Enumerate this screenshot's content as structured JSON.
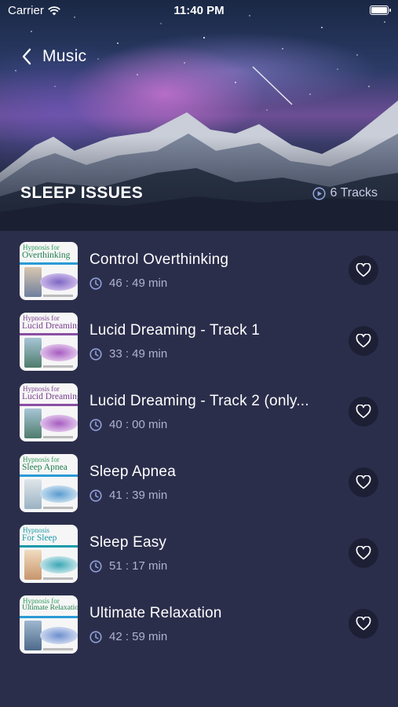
{
  "status_bar": {
    "carrier": "Carrier",
    "time": "11:40 PM"
  },
  "header": {
    "back_label": "Music",
    "title": "SLEEP ISSUES",
    "track_count": "6 Tracks"
  },
  "colors": {
    "list_bg": "#2b2e4b",
    "fav_bg": "#1d1f35",
    "muted_text": "#aeb3cf",
    "accent": "#8fa0d8"
  },
  "tracks": [
    {
      "title": "Control Overthinking",
      "duration": "46 : 49 min",
      "cover_top": "Hypnosis for",
      "cover_main": "Overthinking"
    },
    {
      "title": "Lucid Dreaming - Track 1",
      "duration": "33 : 49 min",
      "cover_top": "Hypnosis for",
      "cover_main": "Lucid Dreaming"
    },
    {
      "title": "Lucid Dreaming - Track 2 (only...",
      "duration": "40 : 00 min",
      "cover_top": "Hypnosis for",
      "cover_main": "Lucid Dreaming"
    },
    {
      "title": "Sleep Apnea",
      "duration": "41 : 39 min",
      "cover_top": "Hypnosis for",
      "cover_main": "Sleep Apnea"
    },
    {
      "title": "Sleep Easy",
      "duration": "51 : 17 min",
      "cover_top": "Hypnosis",
      "cover_main": "For Sleep"
    },
    {
      "title": "Ultimate Relaxation",
      "duration": "42 : 59 min",
      "cover_top": "Hypnosis for",
      "cover_main": "Ultimate Relaxation"
    }
  ],
  "icons": {
    "back": "chevron-left-icon",
    "tracks": "play-circle-icon",
    "duration": "clock-icon",
    "favorite": "heart-icon",
    "wifi": "wifi-icon",
    "battery": "battery-icon"
  }
}
